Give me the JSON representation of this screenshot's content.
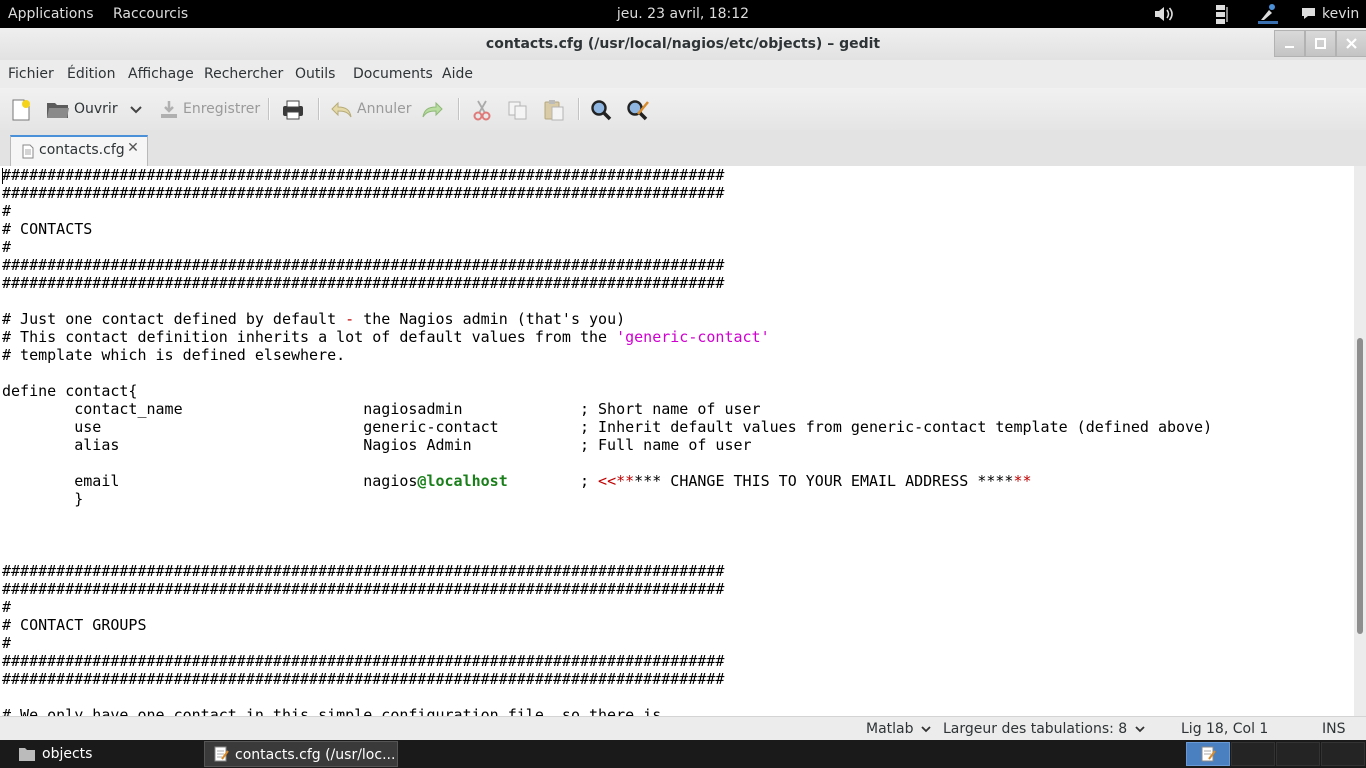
{
  "top_panel": {
    "applications": "Applications",
    "shortcuts": "Raccourcis",
    "clock": "jeu. 23 avril, 18:12",
    "user": "kevin"
  },
  "window": {
    "title": "contacts.cfg (/usr/local/nagios/etc/objects) – gedit"
  },
  "menu": [
    "Fichier",
    "Édition",
    "Affichage",
    "Rechercher",
    "Outils",
    "Documents",
    "Aide"
  ],
  "toolbar": {
    "open_label": "Ouvrir",
    "save_label": "Enregistrer",
    "undo_label": "Annuler"
  },
  "tab": {
    "label": "contacts.cfg"
  },
  "editor": {
    "lines": [
      "################################################################################",
      "################################################################################",
      "#",
      "# CONTACTS",
      "#",
      "################################################################################",
      "################################################################################",
      "",
      "# Just one contact defined by default - the Nagios admin (that's you)",
      "# This contact definition inherits a lot of default values from the 'generic-contact'",
      "# template which is defined elsewhere.",
      "",
      "define contact{",
      "        contact_name                    nagiosadmin             ; Short name of user",
      "        use                             generic-contact         ; Inherit default values from generic-contact template (defined above)",
      "        alias                           Nagios Admin            ; Full name of user",
      "",
      "        email                           nagios@localhost        ; <<***** CHANGE THIS TO YOUR EMAIL ADDRESS ******",
      "        }",
      "",
      "",
      "",
      "################################################################################",
      "################################################################################",
      "#",
      "# CONTACT GROUPS",
      "#",
      "################################################################################",
      "################################################################################",
      "",
      "# We only have one contact in this simple configuration file, so there is"
    ]
  },
  "statusbar": {
    "language": "Matlab",
    "tab_width": "Largeur des tabulations:  8",
    "position": "Lig 18, Col 1",
    "mode": "INS"
  },
  "taskbar": {
    "items": [
      "objects",
      "contacts.cfg (/usr/loc..."
    ]
  },
  "colors": {
    "string": "#d000d0",
    "operator": "#c00000",
    "at_keyword": "#1a7f1a",
    "tab_accent": "#4a90d9"
  }
}
